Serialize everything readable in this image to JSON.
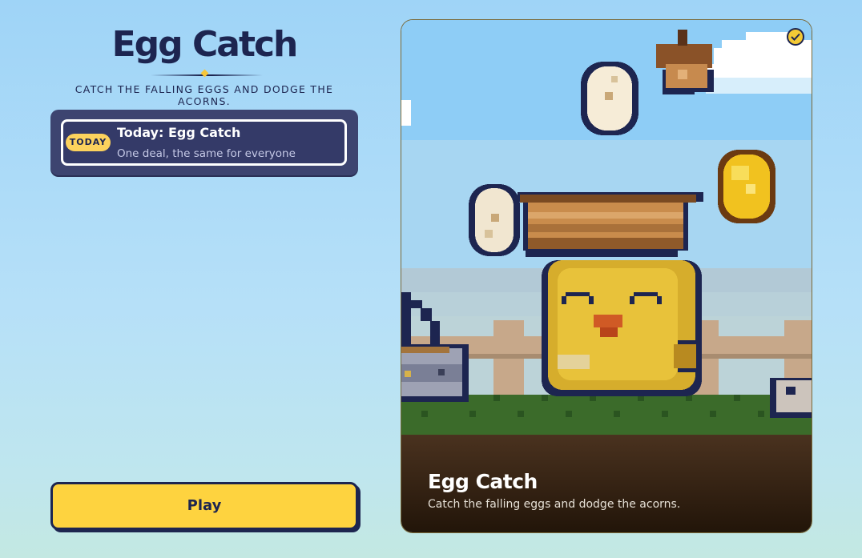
{
  "header": {
    "title": "Egg Catch",
    "subtitle": "CATCH THE FALLING EGGS AND DODGE THE ACORNS."
  },
  "today": {
    "badge": "TODAY",
    "title": "Today: Egg Catch",
    "subtitle": "One deal, the same for everyone"
  },
  "play_button": {
    "label": "Play"
  },
  "game_card": {
    "title": "Egg Catch",
    "subtitle": "Catch the falling eggs and dodge the acorns.",
    "selected_icon": "check-icon"
  },
  "colors": {
    "accent": "#fed33f",
    "navy": "#1d2550",
    "card_panel": "#3d4470"
  }
}
